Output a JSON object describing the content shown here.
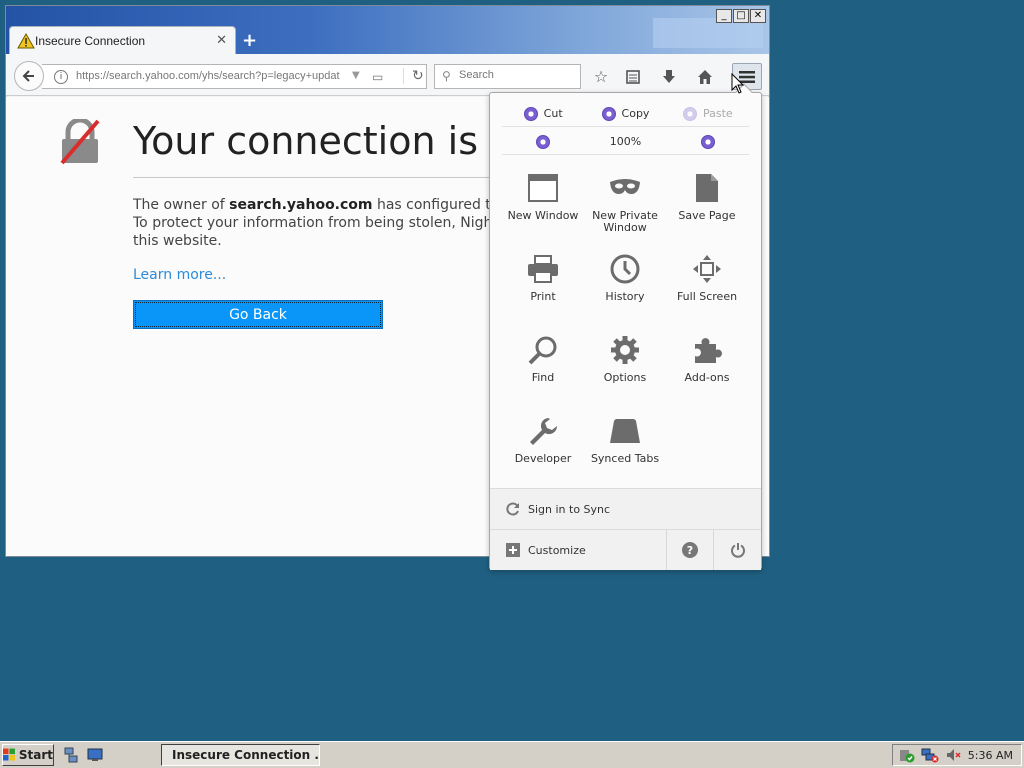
{
  "window": {
    "tab_title": "Insecure Connection",
    "new_tab_label": "+",
    "controls": [
      "_",
      "□",
      "✕"
    ]
  },
  "navbar": {
    "url": "https://search.yahoo.com/yhs/search?p=legacy+updat",
    "search_placeholder": "Search"
  },
  "page": {
    "heading": "Your connection is not secure",
    "desc_owner_prefix": "The owner of ",
    "desc_domain": "search.yahoo.com",
    "desc_owner_suffix": " has configured their website improperly.",
    "desc_line2": "To protect your information from being stolen, Nightly has not connected to",
    "desc_line3": "this website.",
    "learn_more": "Learn more...",
    "go_back": "Go Back"
  },
  "menu": {
    "edit": {
      "cut": "Cut",
      "copy": "Copy",
      "paste": "Paste"
    },
    "zoom": {
      "level": "100%"
    },
    "items": [
      {
        "label": "New Window",
        "icon": "window-icon"
      },
      {
        "label": "New Private Window",
        "icon": "mask-icon"
      },
      {
        "label": "Save Page",
        "icon": "page-icon"
      },
      {
        "label": "Print",
        "icon": "printer-icon"
      },
      {
        "label": "History",
        "icon": "clock-icon"
      },
      {
        "label": "Full Screen",
        "icon": "fullscreen-icon"
      },
      {
        "label": "Find",
        "icon": "magnifier-icon"
      },
      {
        "label": "Options",
        "icon": "gear-icon"
      },
      {
        "label": "Add-ons",
        "icon": "puzzle-icon"
      },
      {
        "label": "Developer",
        "icon": "wrench-icon"
      },
      {
        "label": "Synced Tabs",
        "icon": "synced-tabs-icon"
      }
    ],
    "sign_in": "Sign in to Sync",
    "customize": "Customize"
  },
  "taskbar": {
    "start": "Start",
    "task_item": "Insecure Connection ...",
    "clock": "5:36 AM"
  },
  "colors": {
    "desktop": "#1f6082",
    "accent_blue": "#0996f8",
    "link": "#2d8bd7"
  }
}
